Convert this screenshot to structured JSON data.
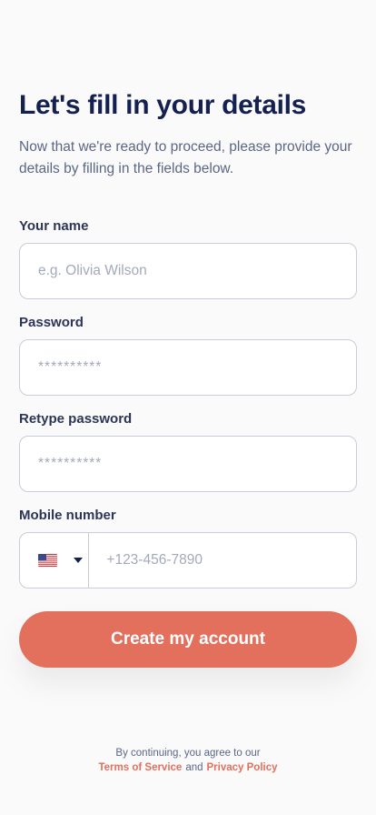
{
  "header": {
    "title": "Let's fill in your details",
    "subtitle": "Now that we're ready to proceed, please provide your details by filling in the fields below."
  },
  "form": {
    "name": {
      "label": "Your name",
      "placeholder": "e.g. Olivia Wilson"
    },
    "password": {
      "label": "Password",
      "placeholder": "**********"
    },
    "retype_password": {
      "label": "Retype password",
      "placeholder": "**********"
    },
    "mobile": {
      "label": "Mobile number",
      "country_flag_icon": "us-flag-icon",
      "placeholder": "+123-456-7890"
    },
    "submit_label": "Create my account"
  },
  "footer": {
    "agree_text": "By continuing, you agree to our",
    "terms_label": "Terms of Service",
    "and_text": "and",
    "privacy_label": "Privacy Policy"
  },
  "colors": {
    "accent": "#e2705d",
    "title": "#14204f",
    "label": "#2c3556",
    "muted": "#5c6685",
    "border": "#c9cdd9",
    "background": "#fafafa"
  }
}
